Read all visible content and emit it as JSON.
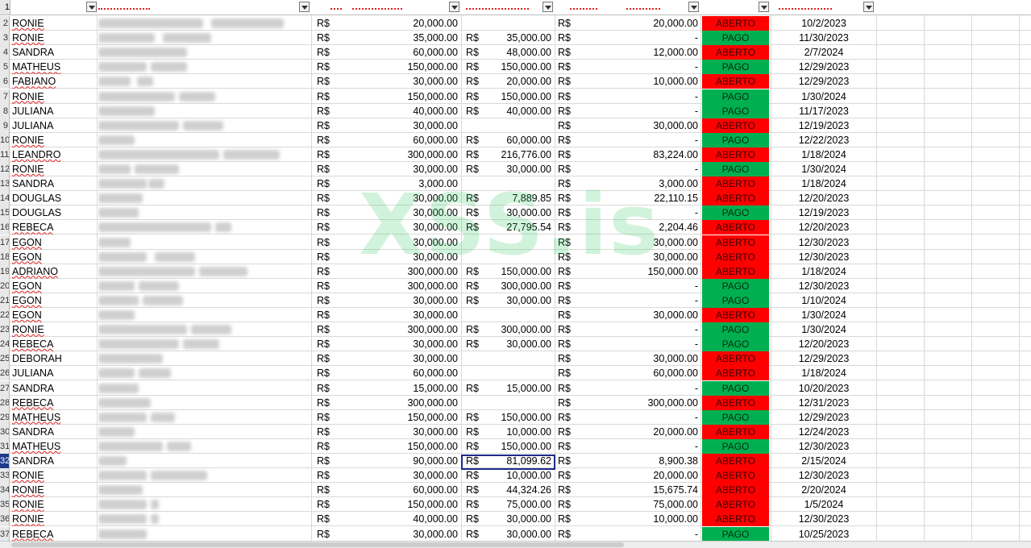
{
  "header": {
    "row_number": "1"
  },
  "rows": [
    {
      "n": "2",
      "name": "RONIE",
      "v1": "20,000.00",
      "rs2": "",
      "v2": "",
      "v3": "20,000.00",
      "status": "ABERTO",
      "date": "10/2/2023"
    },
    {
      "n": "3",
      "name": "RONIE",
      "v1": "35,000.00",
      "rs2": "R$",
      "v2": "35,000.00",
      "v3": "-",
      "status": "PAGO",
      "date": "11/30/2023"
    },
    {
      "n": "4",
      "name": "SANDRA",
      "v1": "60,000.00",
      "rs2": "R$",
      "v2": "48,000.00",
      "v3": "12,000.00",
      "status": "ABERTO",
      "date": "2/7/2024"
    },
    {
      "n": "5",
      "name": "MATHEUS",
      "v1": "150,000.00",
      "rs2": "R$",
      "v2": "150,000.00",
      "v3": "-",
      "status": "PAGO",
      "date": "12/29/2023"
    },
    {
      "n": "6",
      "name": "FABIANO",
      "v1": "30,000.00",
      "rs2": "R$",
      "v2": "20,000.00",
      "v3": "10,000.00",
      "status": "ABERTO",
      "date": "12/29/2023"
    },
    {
      "n": "7",
      "name": "RONIE",
      "v1": "150,000.00",
      "rs2": "R$",
      "v2": "150,000.00",
      "v3": "-",
      "status": "PAGO",
      "date": "1/30/2024"
    },
    {
      "n": "8",
      "name": "JULIANA",
      "v1": "40,000.00",
      "rs2": "R$",
      "v2": "40,000.00",
      "v3": "-",
      "status": "PAGO",
      "date": "11/17/2023"
    },
    {
      "n": "9",
      "name": "JULIANA",
      "v1": "30,000.00",
      "rs2": "",
      "v2": "",
      "v3": "30,000.00",
      "status": "ABERTO",
      "date": "12/19/2023"
    },
    {
      "n": "10",
      "name": "RONIE",
      "v1": "60,000.00",
      "rs2": "R$",
      "v2": "60,000.00",
      "v3": "-",
      "status": "PAGO",
      "date": "12/22/2023"
    },
    {
      "n": "11",
      "name": "LEANDRO",
      "v1": "300,000.00",
      "rs2": "R$",
      "v2": "216,776.00",
      "v3": "83,224.00",
      "status": "ABERTO",
      "date": "1/18/2024"
    },
    {
      "n": "12",
      "name": "RONIE",
      "v1": "30,000.00",
      "rs2": "R$",
      "v2": "30,000.00",
      "v3": "-",
      "status": "PAGO",
      "date": "1/30/2024"
    },
    {
      "n": "13",
      "name": "SANDRA",
      "v1": "3,000.00",
      "rs2": "",
      "v2": "",
      "v3": "3,000.00",
      "status": "ABERTO",
      "date": "1/18/2024"
    },
    {
      "n": "14",
      "name": "DOUGLAS",
      "v1": "30,000.00",
      "rs2": "R$",
      "v2": "7,889.85",
      "v3": "22,110.15",
      "status": "ABERTO",
      "date": "12/20/2023"
    },
    {
      "n": "15",
      "name": "DOUGLAS",
      "v1": "30,000.00",
      "rs2": "R$",
      "v2": "30,000.00",
      "v3": "-",
      "status": "PAGO",
      "date": "12/19/2023"
    },
    {
      "n": "16",
      "name": "REBECA",
      "v1": "30,000.00",
      "rs2": "R$",
      "v2": "27,795.54",
      "v3": "2,204.46",
      "status": "ABERTO",
      "date": "12/20/2023"
    },
    {
      "n": "17",
      "name": "EGON",
      "v1": "30,000.00",
      "rs2": "",
      "v2": "",
      "v3": "30,000.00",
      "status": "ABERTO",
      "date": "12/30/2023"
    },
    {
      "n": "18",
      "name": "EGON",
      "v1": "30,000.00",
      "rs2": "",
      "v2": "",
      "v3": "30,000.00",
      "status": "ABERTO",
      "date": "12/30/2023"
    },
    {
      "n": "19",
      "name": "ADRIANO",
      "v1": "300,000.00",
      "rs2": "R$",
      "v2": "150,000.00",
      "v3": "150,000.00",
      "status": "ABERTO",
      "date": "1/18/2024"
    },
    {
      "n": "20",
      "name": "EGON",
      "v1": "300,000.00",
      "rs2": "R$",
      "v2": "300,000.00",
      "v3": "-",
      "status": "PAGO",
      "date": "12/30/2023"
    },
    {
      "n": "21",
      "name": "EGON",
      "v1": "30,000.00",
      "rs2": "R$",
      "v2": "30,000.00",
      "v3": "-",
      "status": "PAGO",
      "date": "1/10/2024"
    },
    {
      "n": "22",
      "name": "EGON",
      "v1": "30,000.00",
      "rs2": "",
      "v2": "",
      "v3": "30,000.00",
      "status": "ABERTO",
      "date": "1/30/2024"
    },
    {
      "n": "23",
      "name": "RONIE",
      "v1": "300,000.00",
      "rs2": "R$",
      "v2": "300,000.00",
      "v3": "-",
      "status": "PAGO",
      "date": "1/30/2024"
    },
    {
      "n": "24",
      "name": "REBECA",
      "v1": "30,000.00",
      "rs2": "R$",
      "v2": "30,000.00",
      "v3": "-",
      "status": "PAGO",
      "date": "12/20/2023"
    },
    {
      "n": "25",
      "name": "DEBORAH",
      "v1": "30,000.00",
      "rs2": "",
      "v2": "",
      "v3": "30,000.00",
      "status": "ABERTO",
      "date": "12/29/2023"
    },
    {
      "n": "26",
      "name": "JULIANA",
      "v1": "60,000.00",
      "rs2": "",
      "v2": "",
      "v3": "60,000.00",
      "status": "ABERTO",
      "date": "1/18/2024"
    },
    {
      "n": "27",
      "name": "SANDRA",
      "v1": "15,000.00",
      "rs2": "R$",
      "v2": "15,000.00",
      "v3": "-",
      "status": "PAGO",
      "date": "10/20/2023"
    },
    {
      "n": "28",
      "name": "REBECA",
      "v1": "300,000.00",
      "rs2": "",
      "v2": "",
      "v3": "300,000.00",
      "status": "ABERTO",
      "date": "12/31/2023"
    },
    {
      "n": "29",
      "name": "MATHEUS",
      "v1": "150,000.00",
      "rs2": "R$",
      "v2": "150,000.00",
      "v3": "-",
      "status": "PAGO",
      "date": "12/29/2023"
    },
    {
      "n": "30",
      "name": "SANDRA",
      "v1": "30,000.00",
      "rs2": "R$",
      "v2": "10,000.00",
      "v3": "20,000.00",
      "status": "ABERTO",
      "date": "12/24/2023"
    },
    {
      "n": "31",
      "name": "MATHEUS",
      "v1": "150,000.00",
      "rs2": "R$",
      "v2": "150,000.00",
      "v3": "-",
      "status": "PAGO",
      "date": "12/30/2023"
    },
    {
      "n": "32",
      "name": "SANDRA",
      "v1": "90,000.00",
      "rs2": "R$",
      "v2": "81,099.62",
      "v3": "8,900.38",
      "status": "ABERTO",
      "date": "2/15/2024"
    },
    {
      "n": "33",
      "name": "RONIE",
      "v1": "30,000.00",
      "rs2": "R$",
      "v2": "10,000.00",
      "v3": "20,000.00",
      "status": "ABERTO",
      "date": "12/30/2023"
    },
    {
      "n": "34",
      "name": "RONIE",
      "v1": "60,000.00",
      "rs2": "R$",
      "v2": "44,324.26",
      "v3": "15,675.74",
      "status": "ABERTO",
      "date": "2/20/2024"
    },
    {
      "n": "35",
      "name": "RONIE",
      "v1": "150,000.00",
      "rs2": "R$",
      "v2": "75,000.00",
      "v3": "75,000.00",
      "status": "ABERTO",
      "date": "1/5/2024"
    },
    {
      "n": "36",
      "name": "RONIE",
      "v1": "40,000.00",
      "rs2": "R$",
      "v2": "30,000.00",
      "v3": "10,000.00",
      "status": "ABERTO",
      "date": "12/30/2023"
    },
    {
      "n": "37",
      "name": "REBECA",
      "v1": "30,000.00",
      "rs2": "R$",
      "v2": "30,000.00",
      "v3": "-",
      "status": "PAGO",
      "date": "10/25/2023"
    }
  ],
  "currency_label": "R$",
  "watermark": "XSS.is",
  "active_row": "32",
  "colors": {
    "aberto": "#ff0000",
    "pago": "#00b050",
    "selection": "#1e2a8a"
  }
}
